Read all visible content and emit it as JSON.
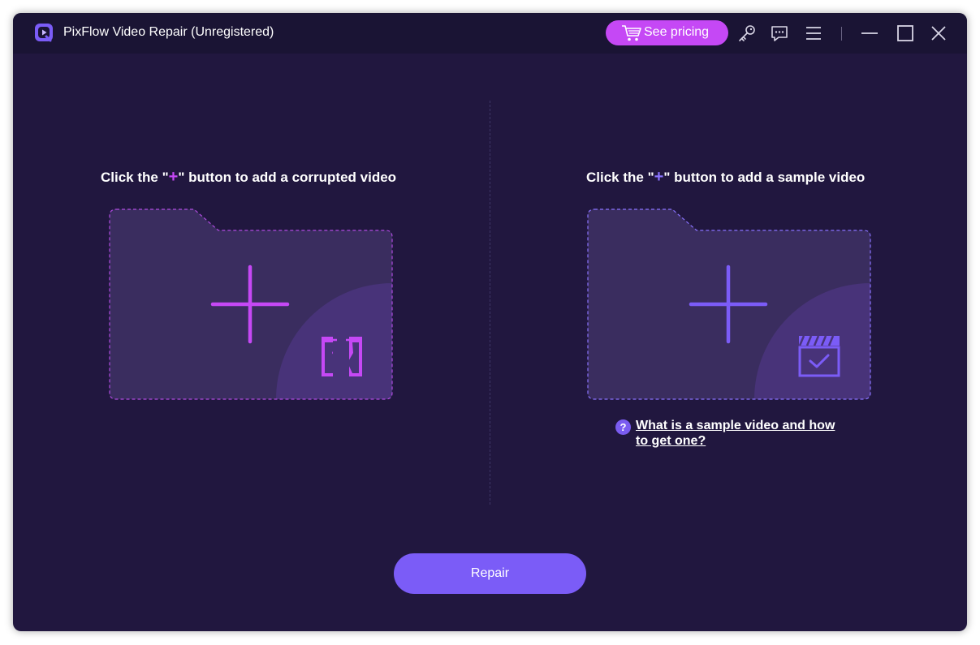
{
  "window": {
    "title": "PixFlow Video Repair (Unregistered)"
  },
  "titlebar": {
    "pricing_label": "See pricing",
    "icons": [
      "cart-icon",
      "key-icon",
      "feedback-icon",
      "menu-icon",
      "minimize-icon",
      "maximize-icon",
      "close-icon"
    ]
  },
  "left_panel": {
    "hint_prefix": "Click the \"",
    "hint_plus": "+",
    "hint_suffix": "\" button to add a corrupted video",
    "icon": "broken-video-icon"
  },
  "right_panel": {
    "hint_prefix": "Click the \"",
    "hint_plus": "+",
    "hint_suffix": "\" button to add a sample video",
    "icon": "video-check-icon",
    "help_mark": "?",
    "help_link": "What is a sample video and how to get one?"
  },
  "actions": {
    "repair_label": "Repair"
  },
  "colors": {
    "background": "#21173f",
    "titlebar": "#1a1434",
    "accent_pink": "#c548f5",
    "accent_purple": "#7b5cf7",
    "folder_fill": "#3a2d5f"
  }
}
